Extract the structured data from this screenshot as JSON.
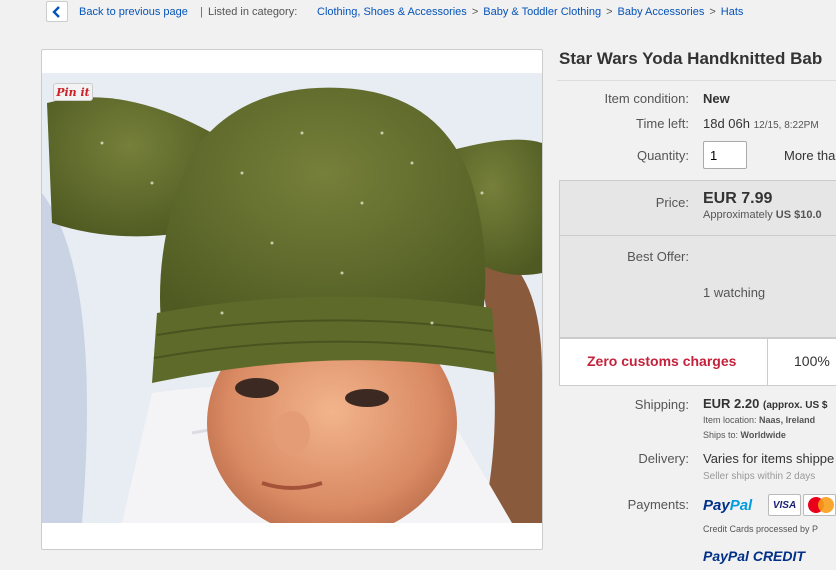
{
  "breadcrumb": {
    "back": "Back to previous page",
    "separator": "|",
    "listed": "Listed in category:",
    "crumbs": [
      "Clothing, Shoes & Accessories",
      "Baby & Toddler Clothing",
      "Baby Accessories",
      "Hats"
    ],
    "arrow": ">"
  },
  "pin_it": "Pin it",
  "item": {
    "title": "Star Wars Yoda Handknitted Bab",
    "condition_label": "Item condition:",
    "condition_value": "New",
    "time_label": "Time left:",
    "time_value": "18d 06h",
    "time_date": "12/15, 8:22PM",
    "quantity_label": "Quantity:",
    "quantity_value": "1",
    "more_than": "More tha"
  },
  "price": {
    "label": "Price:",
    "value": "EUR 7.99",
    "approx_prefix": "Approximately",
    "approx_value": "US $10.0",
    "best_offer_label": "Best Offer:",
    "watching": "1 watching"
  },
  "customs": {
    "text": "Zero customs charges",
    "right": "100% "
  },
  "shipping": {
    "label": "Shipping:",
    "value": "EUR 2.20",
    "approx": "(approx. US $",
    "location_label": "Item location:",
    "location_value": "Naas, Ireland",
    "ships_label": "Ships to:",
    "ships_value": "Worldwide"
  },
  "delivery": {
    "label": "Delivery:",
    "value": "Varies for items shippe",
    "note": "Seller ships within 2 days"
  },
  "payments": {
    "label": "Payments:",
    "paypal_a": "Pay",
    "paypal_b": "Pal",
    "visa": "VISA",
    "cards_note": "Credit Cards processed by P",
    "credit_a": "PayPal",
    "credit_b": "CREDIT"
  },
  "colors": {
    "link": "#0654ba",
    "customs_red": "#c4223c",
    "paypal_dark": "#003087",
    "paypal_light": "#009cde"
  }
}
